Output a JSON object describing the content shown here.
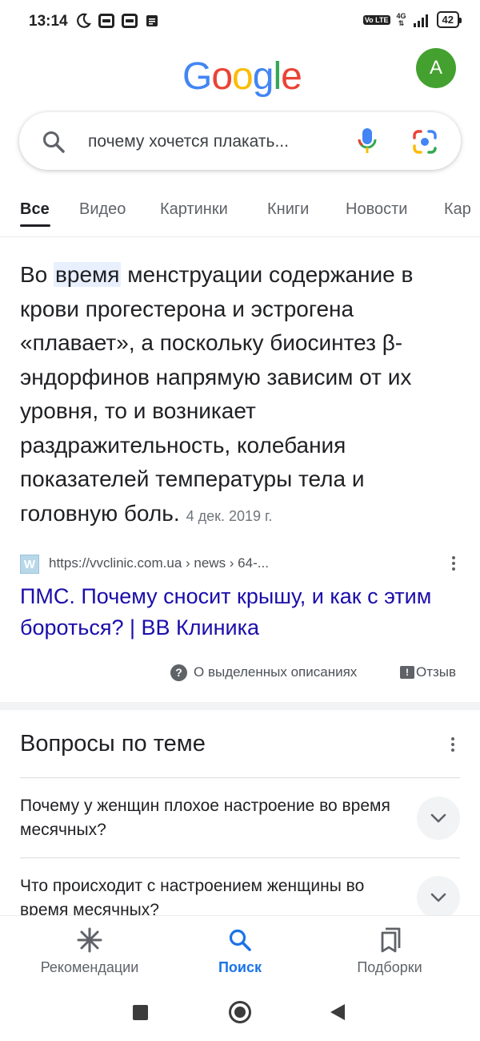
{
  "status_bar": {
    "time": "13:14",
    "volte": "Vo LTE",
    "network": "4G",
    "battery": "42"
  },
  "header": {
    "logo_letters": [
      "G",
      "o",
      "o",
      "g",
      "l",
      "e"
    ],
    "logo_colors": [
      "#4285F4",
      "#EA4335",
      "#FBBC05",
      "#4285F4",
      "#34A853",
      "#EA4335"
    ],
    "avatar_letter": "A",
    "avatar_color": "#44a12f"
  },
  "search": {
    "query": "почему хочется плакать..."
  },
  "tabs": [
    {
      "label": "Все",
      "active": true
    },
    {
      "label": "Видео",
      "active": false
    },
    {
      "label": "Картинки",
      "active": false
    },
    {
      "label": "Книги",
      "active": false
    },
    {
      "label": "Новости",
      "active": false
    },
    {
      "label": "Кар",
      "active": false
    }
  ],
  "snippet": {
    "lead": "Во ",
    "highlight": "время",
    "body": " менструации содержание в крови прогестерона и эстрогена «плавает», а поскольку биосинтез β-эндорфинов напрямую зависим от их уровня, то и возникает раздражительность, колебания показателей температуры тела и головную боль.",
    "date": "4 дек. 2019 г.",
    "source_url": "https://vvclinic.com.ua › news › 64-...",
    "result_title": "ПМС. Почему сносит крышу, и как с этим бороться? | ВВ Клиника",
    "about_label": "О выделенных описаниях",
    "feedback_label": "Отзыв"
  },
  "related": {
    "title": "Вопросы по теме",
    "questions": [
      "Почему у женщин плохое настроение во время месячных?",
      "Что происходит с настроением женщины во время месячных?"
    ]
  },
  "bottom_nav": [
    {
      "label": "Рекомендации",
      "icon": "asterisk-icon",
      "active": false
    },
    {
      "label": "Поиск",
      "icon": "search-icon",
      "active": true
    },
    {
      "label": "Подборки",
      "icon": "collections-icon",
      "active": false
    }
  ],
  "colors": {
    "link": "#1a0dab",
    "accent": "#1a73e8",
    "highlight_bg": "#e8f0fe"
  }
}
